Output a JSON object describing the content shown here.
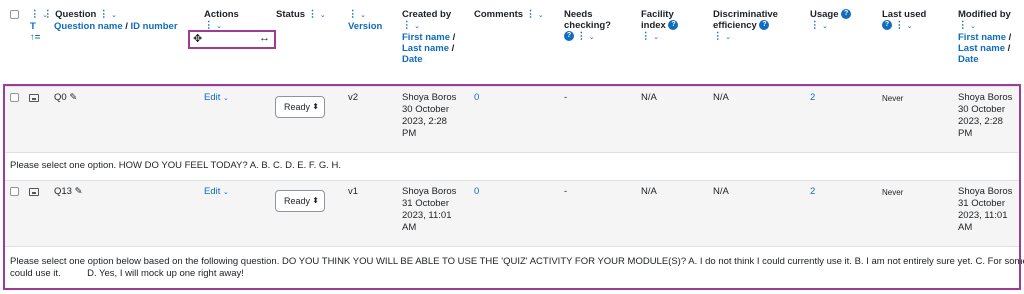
{
  "header": {
    "question_label": "Question",
    "question_sort": "Question name",
    "sep": " / ",
    "id_sort": "ID number",
    "type_letter": "T",
    "actions_label": "Actions",
    "status_label": "Status",
    "version_label": "Version",
    "created_by_label": "Created by",
    "first_name": "First name",
    "last_name": "Last name",
    "date": "Date",
    "comments_label": "Comments",
    "needs_checking_1": "Needs",
    "needs_checking_2": "checking?",
    "facility_1": "Facility",
    "facility_2": "index",
    "discrim_1": "Discriminative",
    "discrim_2": "efficiency",
    "usage_label": "Usage",
    "last_used_label": "Last used",
    "modified_by_label": "Modified by",
    "move_icon": "✥",
    "resize_icon": "↔"
  },
  "questions": [
    {
      "name": "Q0",
      "edit": "Edit",
      "status": "Ready",
      "version": "v2",
      "created_name": "Shoya Boros",
      "created_date_1": "30 October",
      "created_date_2": "2023, 2:28",
      "created_date_3": "PM",
      "comments": "0",
      "needs_checking": "-",
      "facility": "N/A",
      "discrimination": "N/A",
      "usage": "2",
      "last_used": "Never",
      "modified_name": "Shoya Boros",
      "modified_date_1": "30 October",
      "modified_date_2": "2023, 2:28",
      "modified_date_3": "PM",
      "text_line_1": "Please select one option. HOW DO YOU FEEL TODAY? A.   B.   C.   D.    E.    F.  G.   H.",
      "text_line_2": ""
    },
    {
      "name": "Q13",
      "edit": "Edit",
      "status": "Ready",
      "version": "v1",
      "created_name": "Shoya Boros",
      "created_date_1": "31 October",
      "created_date_2": "2023, 11:01",
      "created_date_3": "AM",
      "comments": "0",
      "needs_checking": "-",
      "facility": "N/A",
      "discrimination": "N/A",
      "usage": "2",
      "last_used": "Never",
      "modified_name": "Shoya Boros",
      "modified_date_1": "31 October",
      "modified_date_2": "2023, 11:01",
      "modified_date_3": "AM",
      "text_line_1": "Please select one option below based on the following question. DO YOU THINK YOU WILL BE ABLE TO USE THE 'QUIZ' ACTIVITY FOR YOUR MODULE(S)? A. I do not think I could currently use it.     B. I am not entirely sure yet.      C. For some modules I",
      "text_line_2": "could use it.          D. Yes, I will mock up one right away!"
    }
  ],
  "colors": {
    "accent": "#0f6cbf",
    "highlight_box": "#9b3c98"
  }
}
